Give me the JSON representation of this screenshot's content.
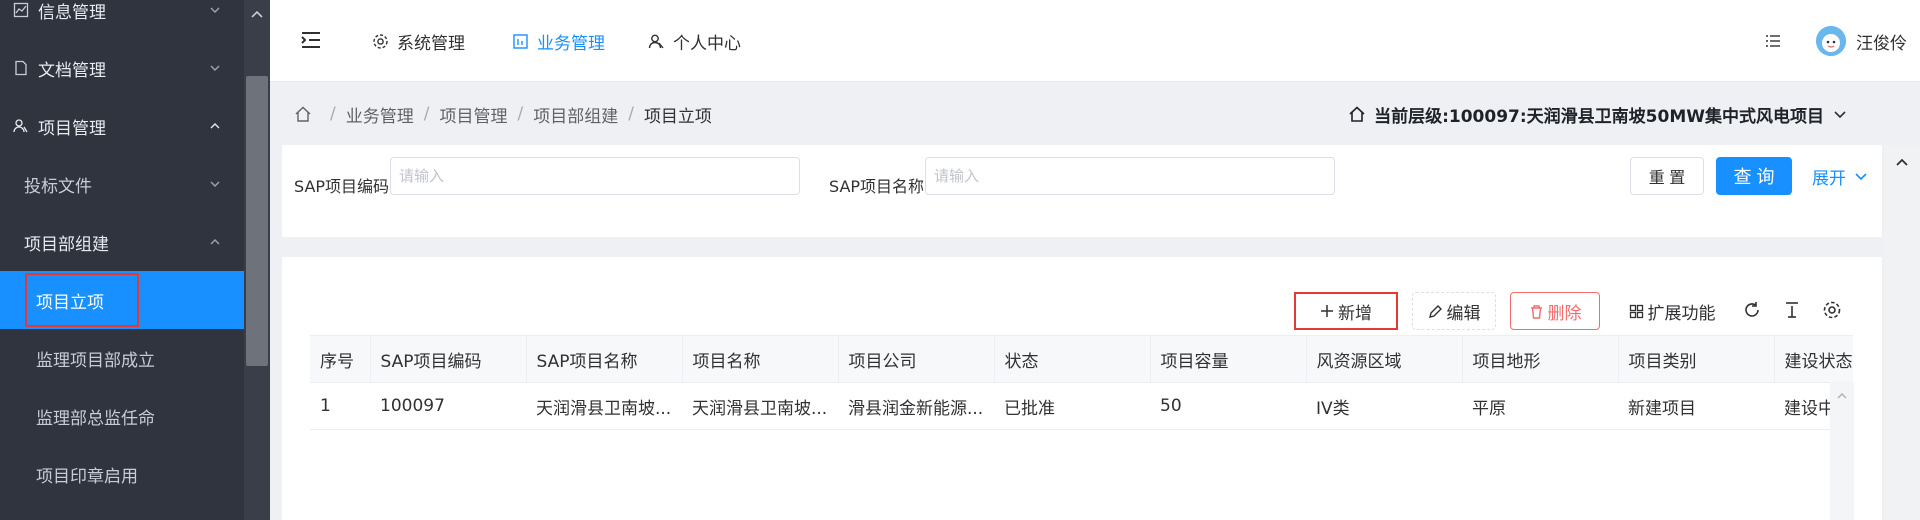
{
  "sidebar": {
    "items": [
      {
        "label": "信息管理",
        "icon": "line-chart-icon",
        "expanded": false
      },
      {
        "label": "文档管理",
        "icon": "document-icon",
        "expanded": false
      },
      {
        "label": "项目管理",
        "icon": "user-group-icon",
        "expanded": true
      },
      {
        "label": "投标文件",
        "expanded": false
      },
      {
        "label": "项目部组建",
        "expanded": true
      },
      {
        "label": "项目立项",
        "active": true
      },
      {
        "label": "监理项目部成立"
      },
      {
        "label": "监理部总监任命"
      },
      {
        "label": "项目印章启用"
      }
    ]
  },
  "topbar": {
    "tabs": [
      {
        "label": "系统管理",
        "icon": "gear-icon"
      },
      {
        "label": "业务管理",
        "icon": "business-icon",
        "active": true
      },
      {
        "label": "个人中心",
        "icon": "user-icon"
      }
    ],
    "username": "汪俊伶"
  },
  "breadcrumb": {
    "items": [
      "业务管理",
      "项目管理",
      "项目部组建",
      "项目立项"
    ],
    "level": "当前层级:100097:天润滑县卫南坡50MW集中式风电项目"
  },
  "search": {
    "fields": [
      {
        "label": "SAP项目编码",
        "placeholder": "请输入"
      },
      {
        "label": "SAP项目名称",
        "placeholder": "请输入"
      }
    ],
    "reset_label": "重 置",
    "query_label": "查 询",
    "expand_label": "展开"
  },
  "toolbar": {
    "add_label": "新增",
    "edit_label": "编辑",
    "delete_label": "删除",
    "extend_label": "扩展功能"
  },
  "table": {
    "headers": [
      "序号",
      "SAP项目编码",
      "SAP项目名称",
      "项目名称",
      "项目公司",
      "状态",
      "项目容量",
      "风资源区域",
      "项目地形",
      "项目类别",
      "建设状态"
    ],
    "rows": [
      [
        "1",
        "100097",
        "天润滑县卫南坡...",
        "天润滑县卫南坡...",
        "滑县润金新能源...",
        "已批准",
        "50",
        "IV类",
        "平原",
        "新建项目",
        "建设中"
      ]
    ]
  },
  "colors": {
    "accent": "#1890ff",
    "sidebar_bg": "#30343f",
    "highlight_box": "#e53935",
    "danger": "#f56c6c"
  }
}
